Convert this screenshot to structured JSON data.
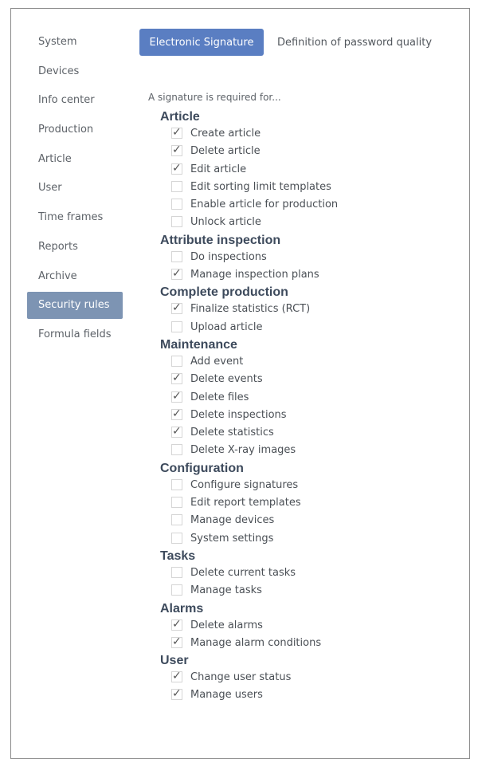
{
  "sidebar": {
    "items": [
      {
        "label": "System",
        "active": false
      },
      {
        "label": "Devices",
        "active": false
      },
      {
        "label": "Info center",
        "active": false
      },
      {
        "label": "Production",
        "active": false
      },
      {
        "label": "Article",
        "active": false
      },
      {
        "label": "User",
        "active": false
      },
      {
        "label": "Time frames",
        "active": false
      },
      {
        "label": "Reports",
        "active": false
      },
      {
        "label": "Archive",
        "active": false
      },
      {
        "label": "Security rules",
        "active": true
      },
      {
        "label": "Formula fields",
        "active": false
      }
    ]
  },
  "tabs": [
    {
      "label": "Electronic Signature",
      "active": true
    },
    {
      "label": "Definition of password quality",
      "active": false
    }
  ],
  "content": {
    "intro": "A signature is required for...",
    "sections": [
      {
        "title": "Article",
        "options": [
          {
            "label": "Create article",
            "checked": true
          },
          {
            "label": "Delete article",
            "checked": true
          },
          {
            "label": "Edit article",
            "checked": true
          },
          {
            "label": "Edit sorting limit templates",
            "checked": false
          },
          {
            "label": "Enable article for production",
            "checked": false
          },
          {
            "label": "Unlock article",
            "checked": false
          }
        ]
      },
      {
        "title": "Attribute inspection",
        "options": [
          {
            "label": "Do inspections",
            "checked": false
          },
          {
            "label": "Manage inspection plans",
            "checked": true
          }
        ]
      },
      {
        "title": "Complete production",
        "options": [
          {
            "label": "Finalize statistics (RCT)",
            "checked": true
          },
          {
            "label": "Upload article",
            "checked": false
          }
        ]
      },
      {
        "title": "Maintenance",
        "options": [
          {
            "label": "Add event",
            "checked": false
          },
          {
            "label": "Delete events",
            "checked": true
          },
          {
            "label": "Delete files",
            "checked": true
          },
          {
            "label": "Delete inspections",
            "checked": true
          },
          {
            "label": "Delete statistics",
            "checked": true
          },
          {
            "label": "Delete X-ray images",
            "checked": false
          }
        ]
      },
      {
        "title": "Configuration",
        "options": [
          {
            "label": "Configure signatures",
            "checked": false
          },
          {
            "label": "Edit report templates",
            "checked": false
          },
          {
            "label": "Manage devices",
            "checked": false
          },
          {
            "label": "System settings",
            "checked": false
          }
        ]
      },
      {
        "title": "Tasks",
        "options": [
          {
            "label": "Delete current tasks",
            "checked": false
          },
          {
            "label": "Manage tasks",
            "checked": false
          }
        ]
      },
      {
        "title": "Alarms",
        "options": [
          {
            "label": "Delete alarms",
            "checked": true
          },
          {
            "label": "Manage alarm conditions",
            "checked": true
          }
        ]
      },
      {
        "title": "User",
        "options": [
          {
            "label": "Change user status",
            "checked": true
          },
          {
            "label": "Manage users",
            "checked": true
          }
        ]
      }
    ]
  },
  "colors": {
    "active_tab": "#5a7ec2",
    "active_sidebar": "#7d94b3",
    "section_title": "#3d4a5c",
    "frame_border": "#8a8a8a"
  },
  "icons": {
    "checkmark": "check-icon"
  }
}
